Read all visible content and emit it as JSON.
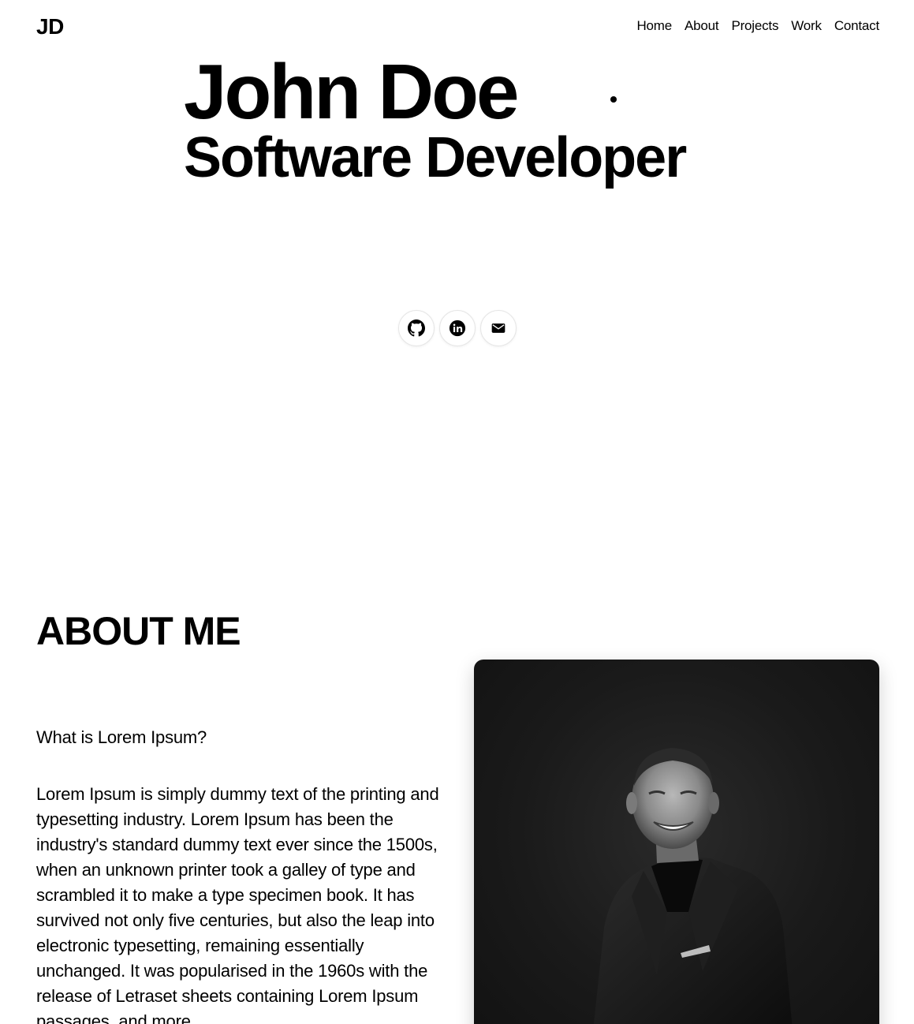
{
  "header": {
    "logo": "JD",
    "nav": [
      {
        "label": "Home"
      },
      {
        "label": "About"
      },
      {
        "label": "Projects"
      },
      {
        "label": "Work"
      },
      {
        "label": "Contact"
      }
    ]
  },
  "hero": {
    "name": "John Doe",
    "role": "Software Developer",
    "social": [
      {
        "icon": "github-icon"
      },
      {
        "icon": "linkedin-icon"
      },
      {
        "icon": "mail-icon"
      }
    ]
  },
  "about": {
    "title": "ABOUT ME",
    "question": "What is Lorem Ipsum?",
    "body": "Lorem Ipsum is simply dummy text of the printing and typesetting industry. Lorem Ipsum has been the industry's standard dummy text ever since the 1500s, when an unknown printer took a galley of type and scrambled it to make a type specimen book. It has survived not only five centuries, but also the leap into electronic typesetting, remaining essentially unchanged. It was popularised in the 1960s with the release of Letraset sheets containing Lorem Ipsum passages, and more"
  },
  "colors": {
    "text": "#000000",
    "background": "#ffffff",
    "portrait_bg": "#1a1a1a"
  }
}
